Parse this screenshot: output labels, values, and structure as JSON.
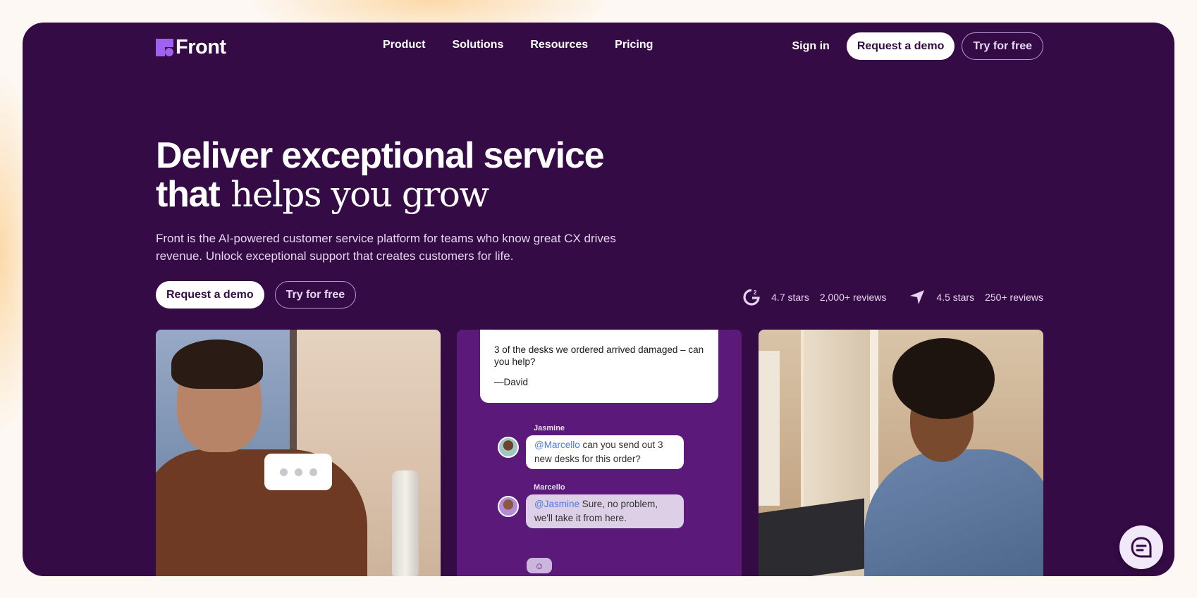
{
  "brand": {
    "name": "Front",
    "accent": "#a061f0",
    "background": "#340b44"
  },
  "nav": {
    "items": [
      {
        "label": "Product"
      },
      {
        "label": "Solutions"
      },
      {
        "label": "Resources"
      },
      {
        "label": "Pricing"
      }
    ],
    "sign_in": "Sign in",
    "request_demo": "Request a demo",
    "try_free": "Try for free"
  },
  "hero": {
    "headline_line1": "Deliver exceptional service",
    "headline_line2_sans": "that",
    "headline_line2_serif": "helps you grow",
    "subtitle": "Front is the AI-powered customer service platform for teams who know great CX drives revenue. Unlock exceptional support that creates customers for life.",
    "cta_primary": "Request a demo",
    "cta_secondary": "Try for free"
  },
  "ratings": [
    {
      "icon": "g2-icon",
      "stars": "4.7 stars",
      "reviews": "2,000+ reviews"
    },
    {
      "icon": "capterra-icon",
      "stars": "4.5 stars",
      "reviews": "250+ reviews"
    }
  ],
  "conversation": {
    "email_body": "3 of the desks we ordered arrived damaged – can you help?",
    "email_signature": "—David",
    "messages": [
      {
        "author": "Jasmine",
        "mention": "@Marcello",
        "text": " can you send out 3 new desks for this order?"
      },
      {
        "author": "Marcello",
        "mention": "@Jasmine",
        "text": " Sure, no problem, we'll take it from here."
      }
    ]
  }
}
